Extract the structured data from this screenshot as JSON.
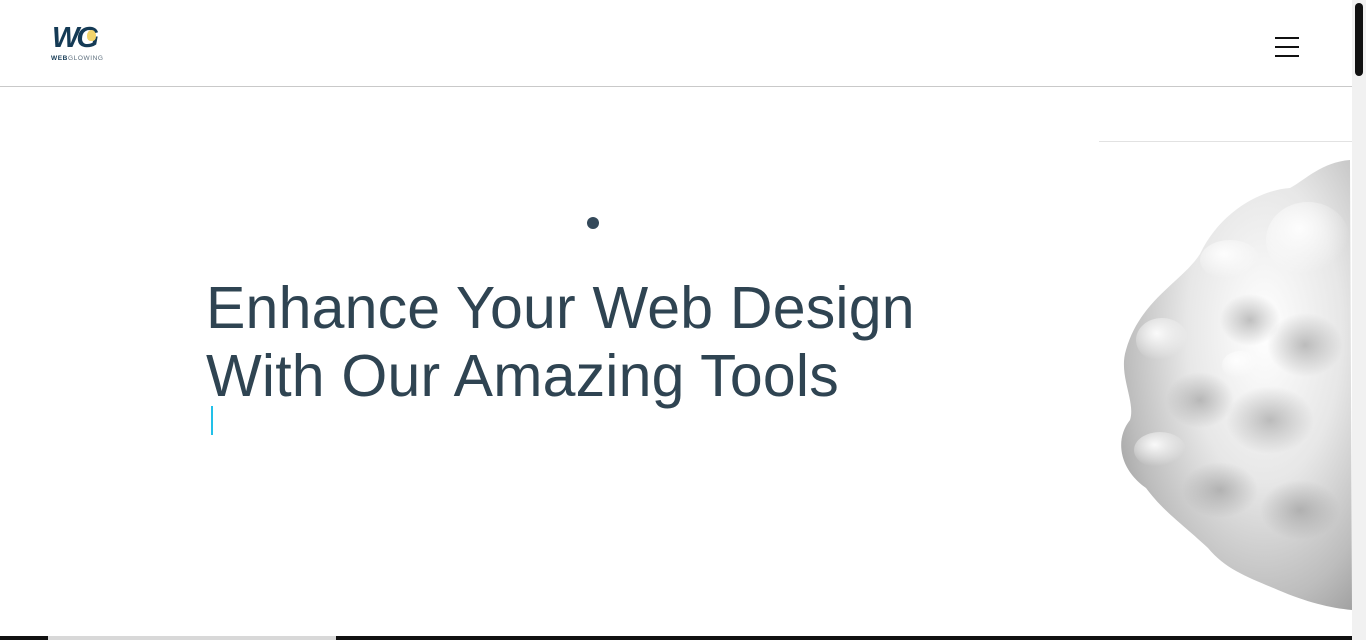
{
  "header": {
    "logo_mark": "WG",
    "logo_text_bold": "WEB",
    "logo_text_light": "GLOWING",
    "menu_icon": "hamburger-menu-icon"
  },
  "hero": {
    "headline_line1": "Enhance Your Web Design",
    "headline_line2": "With Our Amazing Tools",
    "illustration": "3d-blob-sphere"
  },
  "colors": {
    "headline": "#2f4452",
    "caret": "#22c0e8",
    "logo": "#143a55"
  }
}
